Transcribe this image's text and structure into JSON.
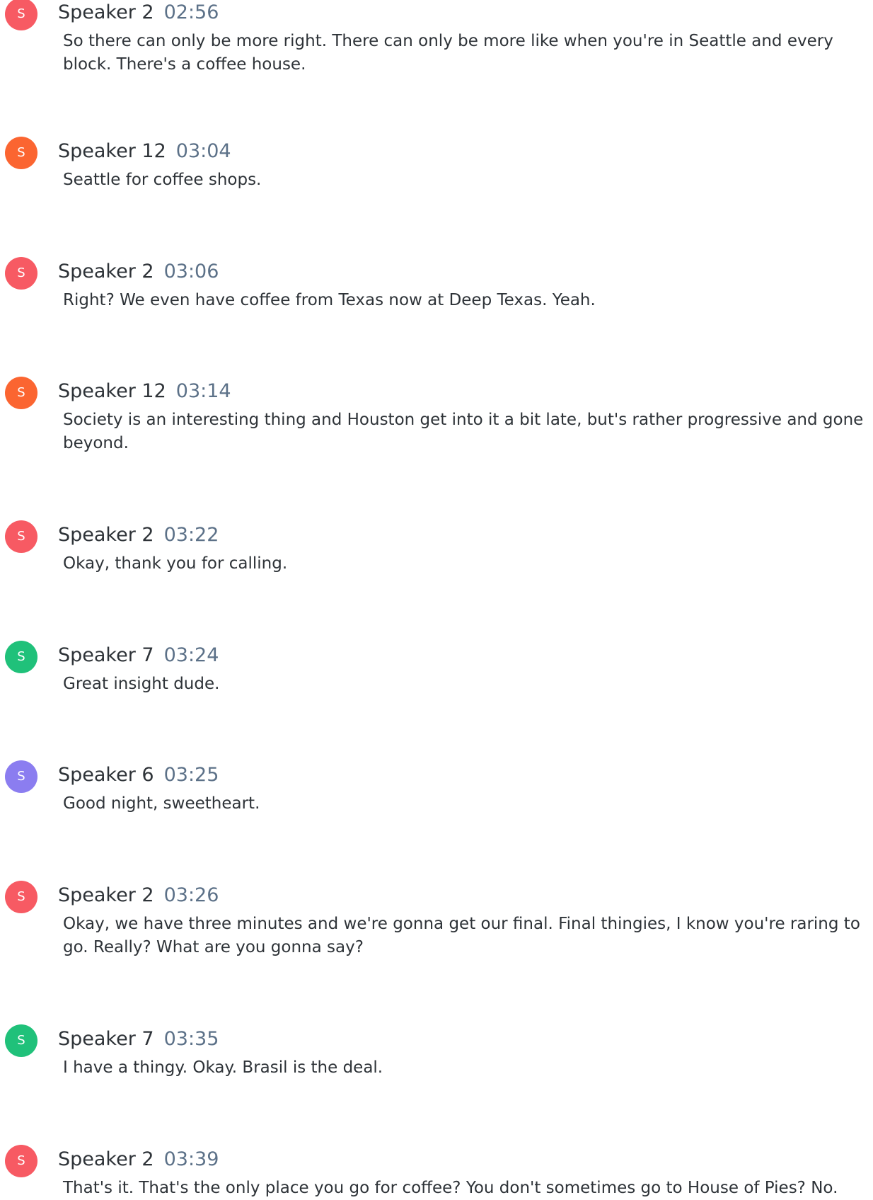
{
  "colors": {
    "speaker_2": "#f75a63",
    "speaker_12": "#fb6531",
    "speaker_7": "#20c17a",
    "speaker_6": "#8b7df0",
    "speaker_name_text": "#2e3338",
    "timestamp_text": "#5c7188",
    "body_text": "#2e3338"
  },
  "entries": [
    {
      "initial": "S",
      "speaker": "Speaker 2",
      "time": "02:56",
      "text": "So there can only be more right. There can only be more like when you're in Seattle and every block. There's a coffee house.",
      "color": "#f75a63"
    },
    {
      "initial": "S",
      "speaker": "Speaker 12",
      "time": "03:04",
      "text": "Seattle for coffee shops.",
      "color": "#fb6531"
    },
    {
      "initial": "S",
      "speaker": "Speaker 2",
      "time": "03:06",
      "text": "Right? We even have coffee from Texas now at Deep Texas. Yeah.",
      "color": "#f75a63"
    },
    {
      "initial": "S",
      "speaker": "Speaker 12",
      "time": "03:14",
      "text": "Society is an interesting thing and Houston get into it a bit late, but's rather progressive and gone beyond.",
      "color": "#fb6531"
    },
    {
      "initial": "S",
      "speaker": "Speaker 2",
      "time": "03:22",
      "text": "Okay, thank you for calling.",
      "color": "#f75a63"
    },
    {
      "initial": "S",
      "speaker": "Speaker 7",
      "time": "03:24",
      "text": "Great insight dude.",
      "color": "#20c17a"
    },
    {
      "initial": "S",
      "speaker": "Speaker 6",
      "time": "03:25",
      "text": "Good night, sweetheart.",
      "color": "#8b7df0"
    },
    {
      "initial": "S",
      "speaker": "Speaker 2",
      "time": "03:26",
      "text": "Okay, we have three minutes and we're gonna get our final. Final thingies, I know you're raring to go. Really? What are you gonna say?",
      "color": "#f75a63"
    },
    {
      "initial": "S",
      "speaker": "Speaker 7",
      "time": "03:35",
      "text": "I have a thingy. Okay. Brasil is the deal.",
      "color": "#20c17a"
    },
    {
      "initial": "S",
      "speaker": "Speaker 2",
      "time": "03:39",
      "text": "That's it. That's the only place you go for coffee? You don't sometimes go to House of Pies? No.",
      "color": "#f75a63"
    }
  ]
}
